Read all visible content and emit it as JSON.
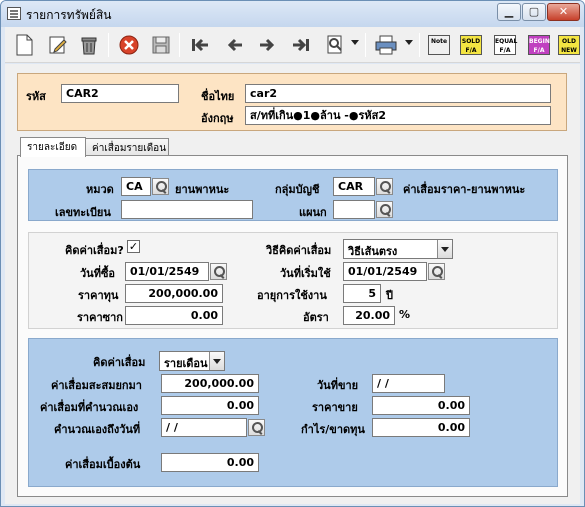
{
  "window": {
    "title": "รายการทรัพย์สิน"
  },
  "toolbar": {
    "badges": [
      {
        "name": "note-icon",
        "text": "Note",
        "bg": "#e8e8e8",
        "fg": "#000"
      },
      {
        "name": "sold-fa-icon",
        "text": "SOLD F/A",
        "bg": "#f4e542",
        "fg": "#000"
      },
      {
        "name": "equal-fa-icon",
        "text": "EQUAL F/A",
        "bg": "#ffffff",
        "fg": "#000"
      },
      {
        "name": "begin-fa-icon",
        "text": "BEGIN F/A",
        "bg": "#c040c0",
        "fg": "#fff"
      },
      {
        "name": "old-new-icon",
        "text": "OLD NEW",
        "bg": "#f4e542",
        "fg": "#000"
      }
    ]
  },
  "header": {
    "code_label": "รหัส",
    "code_value": "CAR2",
    "thai_name_label": "ชื่อไทย",
    "thai_name_value": "car2",
    "english_name_label": "อังกฤษ",
    "english_name_value": "ส/ทที่เกิน●1●ล้าน -●รหัส2"
  },
  "tabs": [
    {
      "label": "รายละเอียด",
      "active": true
    },
    {
      "label": "ค่าเสื่อมรายเดือน",
      "active": false
    }
  ],
  "category_panel": {
    "category_label": "หมวด",
    "category_value": "CA",
    "category_desc": "ยานพาหนะ",
    "account_group_label": "กลุ่มบัญชี",
    "account_group_value": "CAR",
    "account_group_desc": "ค่าเสื่อมราคา-ยานพาหนะ",
    "reg_no_label": "เลขทะเบียน",
    "reg_no_value": "",
    "dept_label": "แผนก",
    "dept_value": ""
  },
  "depreciation_panel": {
    "calc_depr_label": "คิดค่าเสื่อม?",
    "calc_depr_checked": "✓",
    "method_label": "วิธีคิดค่าเสื่อม",
    "method_value": "วิธีเส้นตรง",
    "purchase_date_label": "วันที่ซื้อ",
    "purchase_date_value": "01/01/2549",
    "start_date_label": "วันที่เริ่มใช้",
    "start_date_value": "01/01/2549",
    "cost_label": "ราคาทุน",
    "cost_value": "200,000.00",
    "life_label": "อายุการใช้งาน",
    "life_value": "5",
    "life_unit": "ปี",
    "salvage_label": "ราคาซาก",
    "salvage_value": "0.00",
    "rate_label": "อัตรา",
    "rate_value": "20.00",
    "rate_unit": "%"
  },
  "summary_panel": {
    "calc_label": "คิดค่าเสื่อม",
    "calc_value": "รายเดือน",
    "accum_label": "ค่าเสื่อมสะสมยกมา",
    "accum_value": "200,000.00",
    "sale_date_label": "วันที่ขาย",
    "sale_date_value": "/ /",
    "self_calc_label": "ค่าเสื่อมที่คำนวณเอง",
    "self_calc_value": "0.00",
    "sale_price_label": "ราคาขาย",
    "sale_price_value": "0.00",
    "calc_to_date_label": "คำนวณเองถึงวันที่",
    "calc_to_date_value": "/ /",
    "profit_label": "กำไร/ขาดทุน",
    "profit_value": "0.00",
    "initial_depr_label": "ค่าเสื่อมเบื้องต้น",
    "initial_depr_value": "0.00"
  }
}
